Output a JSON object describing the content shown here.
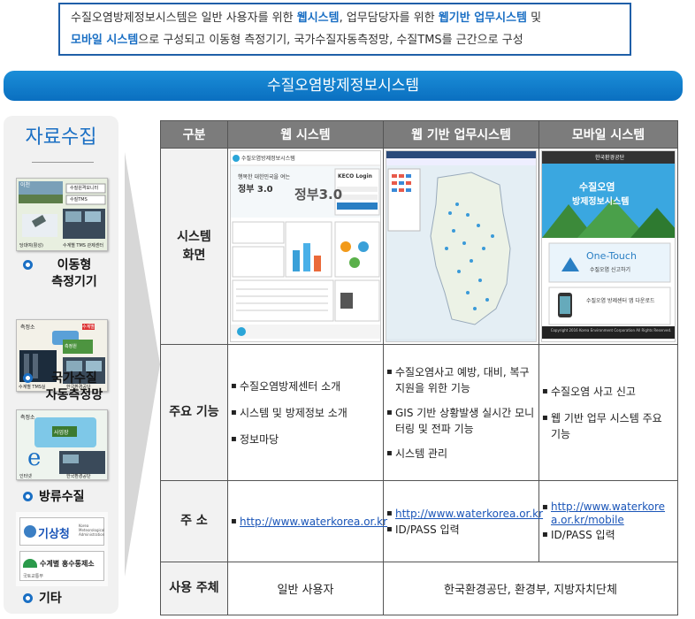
{
  "intro": {
    "p1": "수질오염방제정보시스템은 일반 사용자를 위한 ",
    "h1": "웹시스템",
    "p2": ", 업무담당자를 위한 ",
    "h2": "웹기반 업무시스템",
    "p3": " 및",
    "h3": "모바일 시스템",
    "p4": "으로 구성되고 이동형 측정기기,  국가수질자동측정망, 수질TMS를 근간으로 구성"
  },
  "banner": "수질오염방제정보시스템",
  "left": {
    "title": "자료수집",
    "groups": [
      {
        "label": "이동형\n측정기기",
        "thumb": [
          "이천",
          "수질원격모니터",
          "수질TMS",
          "당대여(활성)",
          "수계별 TMS 관제센터"
        ]
      },
      {
        "label": "국가수질\n자동측정망",
        "thumb": [
          "측정소",
          "수계별",
          "측정원",
          "수계별 TMS실",
          "한국환경공단"
        ]
      },
      {
        "label": "방류수질",
        "thumb": [
          "측정소",
          "사업장",
          "인터넷",
          "한국환경공단"
        ]
      },
      {
        "label": "기타",
        "thumb": [
          "기상청",
          "Korea Meteorological Administration",
          "수계별 홍수통제소",
          "국토교통부"
        ]
      }
    ]
  },
  "table": {
    "headers": [
      "구분",
      "웹 시스템",
      "웹 기반 업무시스템",
      "모바일 시스템"
    ],
    "rows": {
      "screen": {
        "label": "시스템\n화면"
      },
      "func": {
        "label": "주요 기능",
        "web": [
          "수질오염방제센터 소개",
          "시스템 및 방제정보 소개",
          "정보마당"
        ],
        "biz": [
          "수질오염사고 예방, 대비, 복구지원을 위한 기능",
          "GIS 기반 상황발생 실시간 모니터링 및 전파 기능",
          "시스템 관리"
        ],
        "mobile": [
          "수질오염 사고 신고",
          "웹 기반 업무 시스템 주요 기능"
        ]
      },
      "addr": {
        "label": "주 소",
        "web": [
          "http://www.waterkorea.or.kr"
        ],
        "biz": [
          "http://www.waterkorea.or.kr",
          "ID/PASS 입력"
        ],
        "mobile": [
          "http://www.waterkorea.or.kr/mobile",
          "ID/PASS 입력"
        ]
      },
      "user": {
        "label": "사용 주체",
        "web": "일반 사용자",
        "rest": "한국환경공단, 환경부, 지방자치단체"
      }
    }
  },
  "screens": {
    "web": {
      "logo": "수질오염방제정보시스템",
      "slogan": "행복한 대한민국을 여는",
      "gov": "정부 3.0",
      "big": "정부3.0",
      "login": "KECO Login"
    },
    "mobile": {
      "top": "한국환경공단",
      "title1": "수질오염",
      "title2": "방제정보시스템",
      "btn1": "One-Touch",
      "btn1sub": "수질오염 신고하기",
      "btn2": "수질오염 방제센터 앱 다운로드",
      "foot": "Copyright 2016 Korea Environment Corporation All Rights Reserved."
    }
  },
  "colors": {
    "accent": "#1a6fc4",
    "header": "#7c7c7c"
  }
}
